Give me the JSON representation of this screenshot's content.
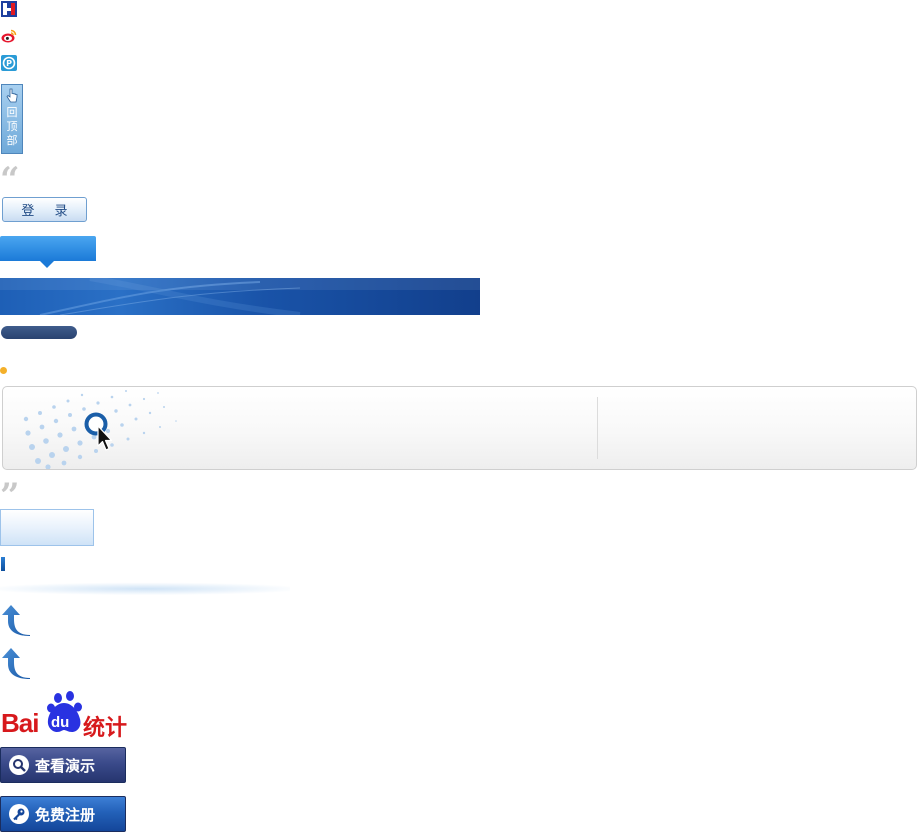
{
  "back_to_top": {
    "label": "回顶部"
  },
  "quotes": {
    "open": "“",
    "close": "”"
  },
  "login": {
    "label": "登 录"
  },
  "baidu_logo": {
    "text_bai": "Bai",
    "text_du": "du",
    "text_tongji": "统计"
  },
  "buttons": {
    "demo": {
      "label": "查看演示",
      "icon": "search-icon"
    },
    "register": {
      "label": "免费注册",
      "icon": "key-icon"
    }
  },
  "icons": {
    "top1": "blue-red-h-logo-icon",
    "top2": "weibo-icon",
    "top3": "p-logo-icon",
    "hand": "pointer-hand-icon",
    "feature": "magnifier-cursor-icon",
    "up_arrow": "curved-up-arrow-icon"
  },
  "colors": {
    "brand_blue": "#1b7ad8",
    "dark_navy": "#2a4370",
    "accent_orange": "#f4b02a",
    "baidu_red": "#d7191c",
    "baidu_blue": "#2932e1"
  }
}
